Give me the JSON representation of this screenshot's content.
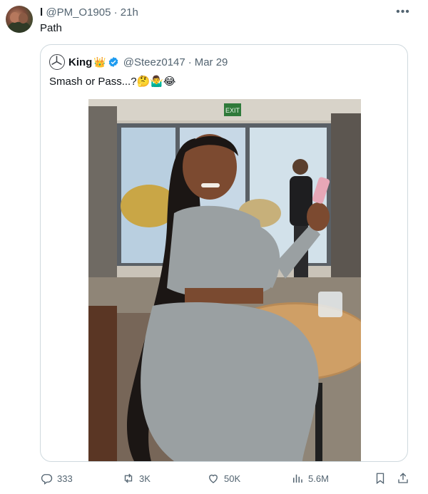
{
  "post": {
    "author_name": "l",
    "handle": "@PM_O1905",
    "separator": "·",
    "time": "21h",
    "text": "Path",
    "more_label": "•••"
  },
  "quoted": {
    "author_name": "King",
    "crown": "👑",
    "handle": "@Steez0147",
    "separator": "·",
    "time": "Mar 29",
    "text": "Smash or Pass...?🤔🤷‍♂️😂",
    "exit_sign": "EXIT"
  },
  "actions": {
    "replies": "333",
    "reposts": "3K",
    "likes": "50K",
    "views": "5.6M"
  },
  "colors": {
    "text": "#0f1419",
    "secondary": "#536471",
    "border": "#cfd9de",
    "verified_blue": "#1d9bf0"
  },
  "icons": [
    "more-icon",
    "verified-badge-icon",
    "reply-icon",
    "repost-icon",
    "like-icon",
    "views-icon",
    "bookmark-icon",
    "share-icon"
  ]
}
